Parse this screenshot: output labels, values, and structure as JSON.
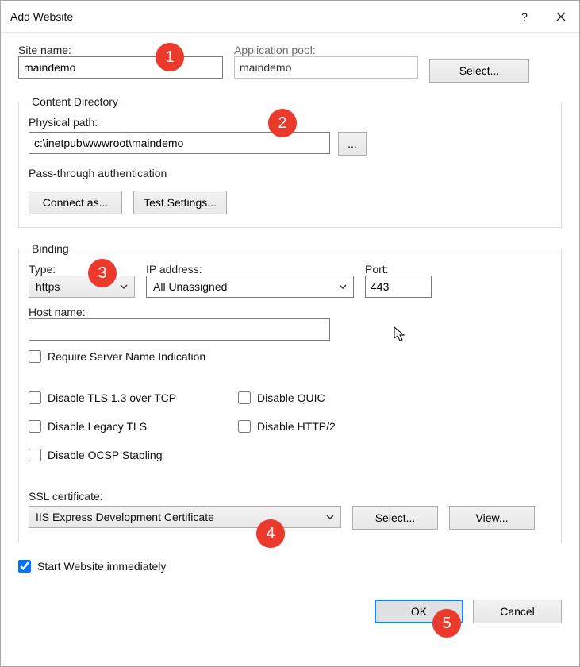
{
  "window": {
    "title": "Add Website",
    "help": "?",
    "close": "✕"
  },
  "top": {
    "site_name_label": "Site name:",
    "site_name_value": "maindemo",
    "app_pool_label": "Application pool:",
    "app_pool_value": "maindemo",
    "select_btn": "Select..."
  },
  "content_dir": {
    "legend": "Content Directory",
    "path_label": "Physical path:",
    "path_value": "c:\\inetpub\\wwwroot\\maindemo",
    "browse": "...",
    "passthrough": "Pass-through authentication",
    "connect_as": "Connect as...",
    "test_settings": "Test Settings..."
  },
  "binding": {
    "legend": "Binding",
    "type_label": "Type:",
    "type_value": "https",
    "ip_label": "IP address:",
    "ip_value": "All Unassigned",
    "port_label": "Port:",
    "port_value": "443",
    "host_label": "Host name:",
    "host_value": "",
    "require_sni": "Require Server Name Indication",
    "disable_tls13": "Disable TLS 1.3 over TCP",
    "disable_quic": "Disable QUIC",
    "disable_legacy": "Disable Legacy TLS",
    "disable_http2": "Disable HTTP/2",
    "disable_ocsp": "Disable OCSP Stapling",
    "ssl_label": "SSL certificate:",
    "ssl_value": "IIS Express Development Certificate",
    "ssl_select": "Select...",
    "ssl_view": "View..."
  },
  "footer": {
    "start_immediate": "Start Website immediately",
    "ok": "OK",
    "cancel": "Cancel"
  },
  "markers": {
    "1": "1",
    "2": "2",
    "3": "3",
    "4": "4",
    "5": "5"
  }
}
